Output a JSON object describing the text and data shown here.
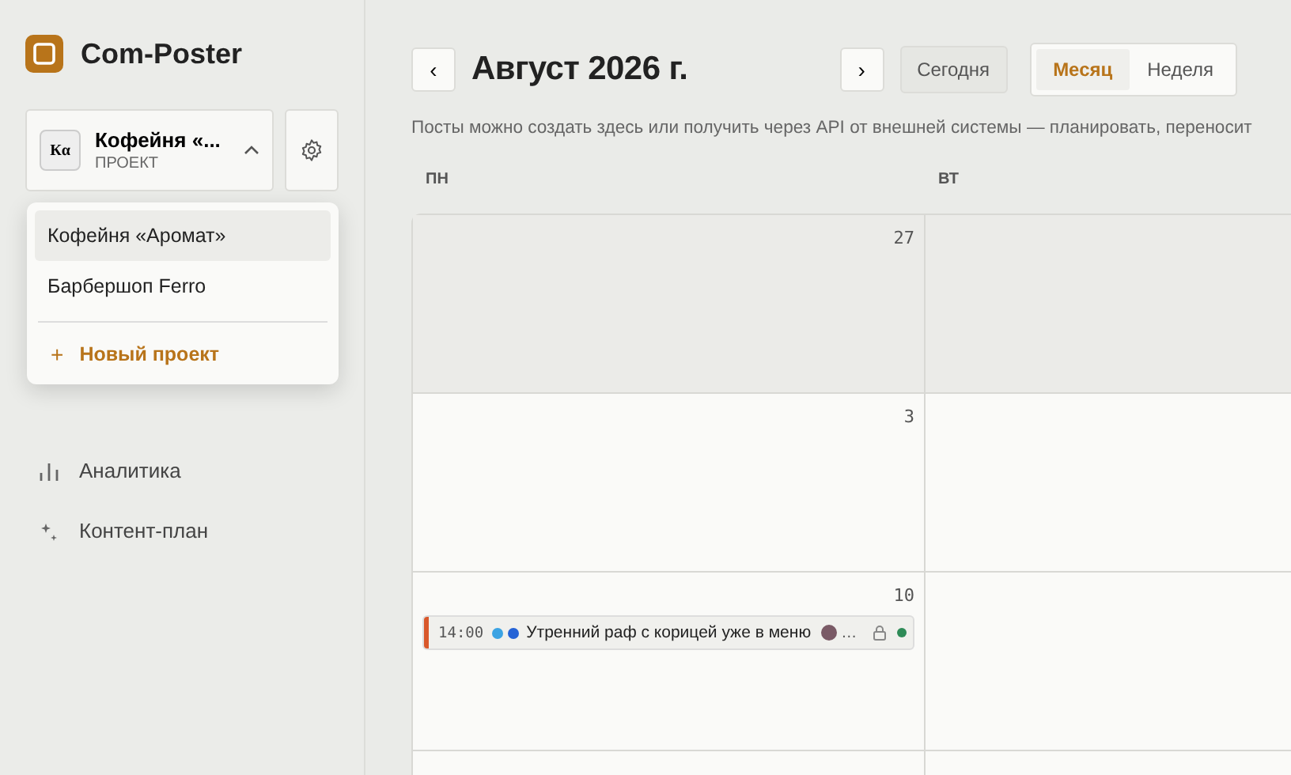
{
  "brand": {
    "name": "Com-Poster"
  },
  "project_switcher": {
    "badge": "Кα",
    "name": "Кофейня «...",
    "caption": "ПРОЕКТ",
    "expanded": true
  },
  "project_menu": {
    "items": [
      {
        "label": "Кофейня «Аромат»",
        "selected": true
      },
      {
        "label": "Барбершоп Ferro",
        "selected": false
      }
    ],
    "new_project": {
      "icon": "+",
      "label": "Новый проект"
    }
  },
  "nav": [
    {
      "kind": "analytics",
      "label": "Аналитика"
    },
    {
      "kind": "sparkle",
      "label": "Контент-план"
    }
  ],
  "header": {
    "prev": "‹",
    "title": "Август 2026 г.",
    "next": "›",
    "today": "Сегодня",
    "views": [
      {
        "label": "Месяц",
        "selected": true
      },
      {
        "label": "Неделя",
        "selected": false
      }
    ]
  },
  "description": "Посты можно создать здесь или получить через API от внешней системы — планировать, переносит",
  "calendar": {
    "columns": [
      "ПН",
      "ВТ"
    ],
    "weeks": [
      {
        "days": [
          {
            "number": "27",
            "outside": true
          },
          {
            "outside": true
          }
        ]
      },
      {
        "days": [
          {
            "number": "3",
            "outside": false
          },
          {
            "outside": false
          }
        ]
      },
      {
        "days": [
          {
            "number": "10",
            "outside": false,
            "events": [
              {
                "time": "14:00",
                "channels": [
                  {
                    "color": "#3ba3e3"
                  },
                  {
                    "color": "#2563d6"
                  }
                ],
                "title": "Утренний раф с корицей уже в меню",
                "more": "…",
                "locked": true,
                "status": {
                  "color": "#2e8b57"
                },
                "color": "#d9582b"
              }
            ]
          },
          {
            "outside": false
          }
        ]
      },
      {
        "days": [
          {
            "outside": false
          },
          {
            "outside": false
          }
        ]
      }
    ]
  }
}
